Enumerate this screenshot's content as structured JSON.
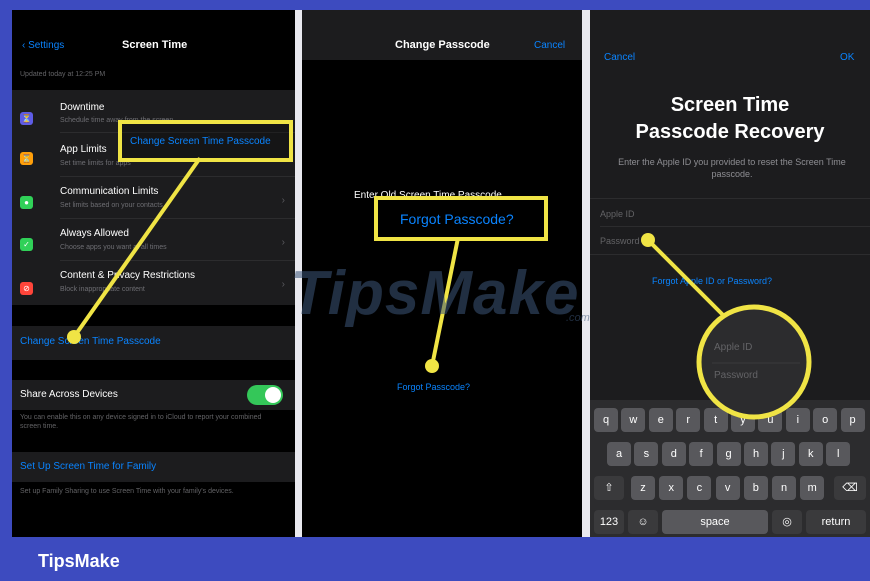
{
  "panel1": {
    "back_label": "Settings",
    "title": "Screen Time",
    "updated": "Updated today at 12:25 PM",
    "rows": [
      {
        "icon": "hourglass-icon",
        "color": "#5e5ce6",
        "title": "Downtime",
        "subtitle": "Schedule time away from the screen"
      },
      {
        "icon": "hourglass-icon",
        "color": "#ff9f0a",
        "title": "App Limits",
        "subtitle": "Set time limits for apps"
      },
      {
        "icon": "chat-icon",
        "color": "#30d158",
        "title": "Communication Limits",
        "subtitle": "Set limits based on your contacts"
      },
      {
        "icon": "check-icon",
        "color": "#30d158",
        "title": "Always Allowed",
        "subtitle": "Choose apps you want at all times"
      },
      {
        "icon": "block-icon",
        "color": "#ff453a",
        "title": "Content & Privacy Restrictions",
        "subtitle": "Block inappropriate content"
      }
    ],
    "change_passcode_link": "Change Screen Time Passcode",
    "share_label": "Share Across Devices",
    "share_desc": "You can enable this on any device signed in to iCloud to report your combined screen time.",
    "family_link": "Set Up Screen Time for Family",
    "family_desc": "Set up Family Sharing to use Screen Time with your family's devices.",
    "callout": "Change Screen Time Passcode"
  },
  "panel2": {
    "title": "Change Passcode",
    "cancel": "Cancel",
    "prompt": "Enter Old Screen Time Passcode",
    "forgot_link": "Forgot Passcode?",
    "callout": "Forgot Passcode?"
  },
  "panel3": {
    "cancel": "Cancel",
    "ok": "OK",
    "title_line1": "Screen Time",
    "title_line2": "Passcode Recovery",
    "desc": "Enter the Apple ID you provided to reset the Screen Time passcode.",
    "appleid_placeholder": "Apple ID",
    "password_placeholder": "Password",
    "forgot_link": "Forgot Apple ID or Password?",
    "zoom_appleid": "Apple ID",
    "zoom_password": "Password",
    "keyboard": {
      "row1": [
        "q",
        "w",
        "e",
        "r",
        "t",
        "y",
        "u",
        "i",
        "o",
        "p"
      ],
      "row2": [
        "a",
        "s",
        "d",
        "f",
        "g",
        "h",
        "j",
        "k",
        "l"
      ],
      "row3": [
        "z",
        "x",
        "c",
        "v",
        "b",
        "n",
        "m"
      ],
      "numbers": "123",
      "space": "space",
      "return": "return"
    }
  },
  "watermark": "TipsMake",
  "watermark_suffix": ".com",
  "brand": "TipsMake",
  "colors": {
    "frame": "#3d4bbf",
    "accent_yellow": "#f0e445",
    "ios_blue": "#0a84ff"
  }
}
